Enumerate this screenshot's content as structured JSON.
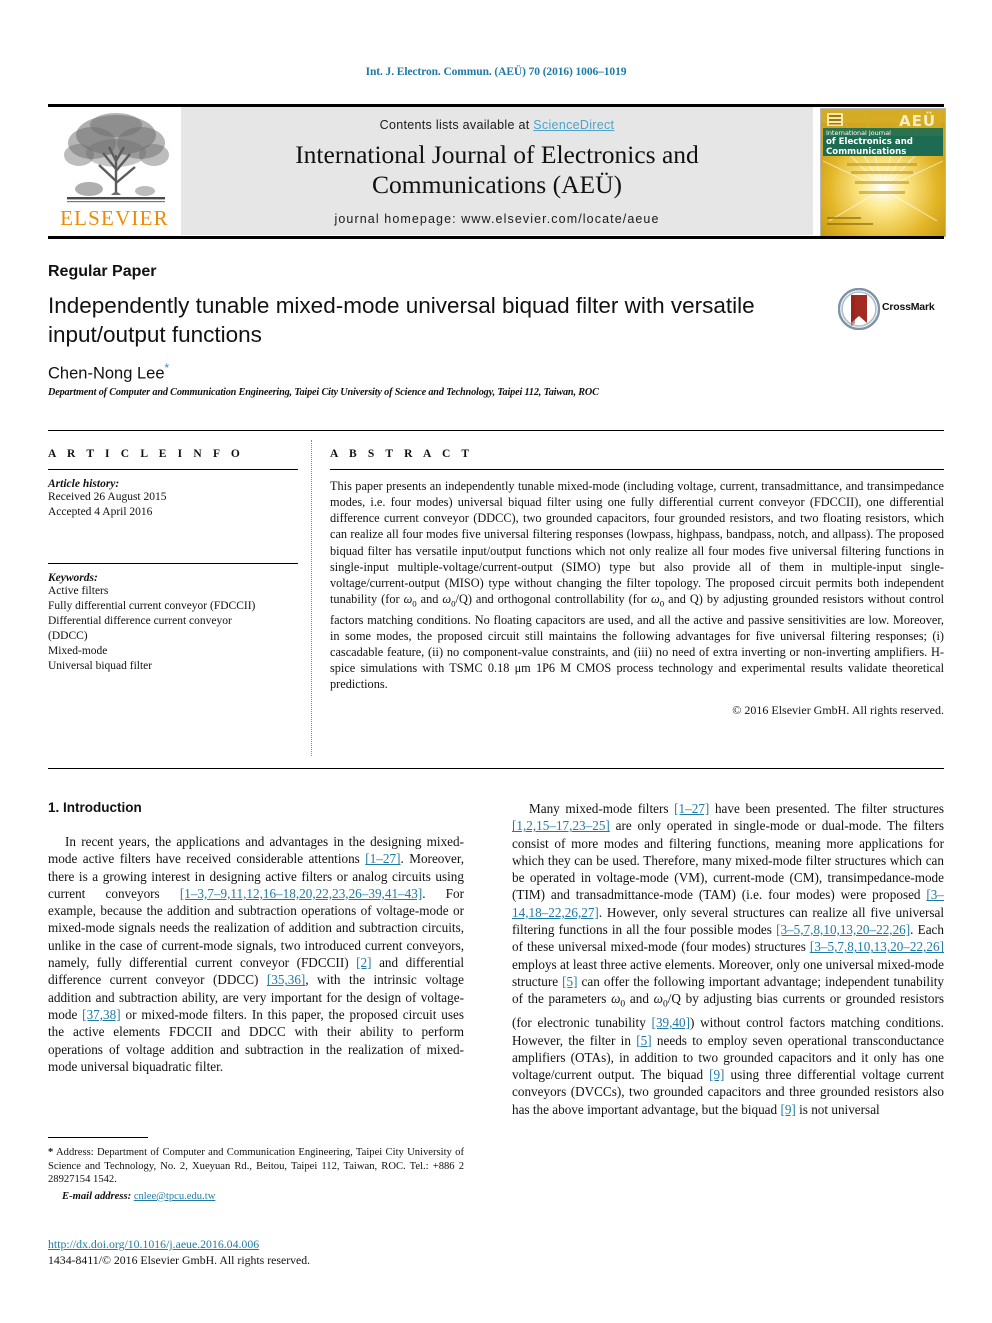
{
  "running_head": "Int. J. Electron. Commun. (AEÜ) 70 (2016) 1006–1019",
  "header": {
    "contents_prefix": "Contents lists available at ",
    "sciencedirect": "ScienceDirect",
    "journal_title_line1": "International Journal of Electronics and",
    "journal_title_line2": "Communications (AEÜ)",
    "homepage": "journal homepage: www.elsevier.com/locate/aeue",
    "publisher_wordmark": "ELSEVIER",
    "cover_line1": "International Journal",
    "cover_line2": "of Electronics and",
    "cover_line3": "Communications",
    "cover_badge": "AEÜ"
  },
  "article": {
    "type": "Regular Paper",
    "title": "Independently tunable mixed-mode universal biquad filter with versatile input/output functions",
    "author": "Chen-Nong Lee",
    "author_footnote_marker": "*",
    "affiliation": "Department of Computer and Communication Engineering, Taipei City University of Science and Technology, Taipei 112, Taiwan, ROC",
    "crossmark_label": "CrossMark"
  },
  "article_info": {
    "heading": "A R T I C L E   I N F O",
    "history_label": "Article history:",
    "history": [
      "Received 26 August 2015",
      "Accepted 4 April 2016"
    ],
    "keywords_label": "Keywords:",
    "keywords": [
      "Active filters",
      "Fully differential current conveyor (FDCCII)",
      "Differential difference current conveyor",
      "(DDCC)",
      "Mixed-mode",
      "Universal biquad filter"
    ]
  },
  "abstract": {
    "heading": "A B S T R A C T",
    "text_part1": "This paper presents an independently tunable mixed-mode (including voltage, current, transadmittance, and transimpedance modes, i.e. four modes) universal biquad filter using one fully differential current conveyor (FDCCII), one differential difference current conveyor (DDCC), two grounded capacitors, four grounded resistors, and two floating resistors, which can realize all four modes five universal filtering responses (lowpass, highpass, bandpass, notch, and allpass). The proposed biquad filter has versatile input/output functions which not only realize all four modes five universal filtering functions in single-input multiple-voltage/current-output (SIMO) type but also provide all of them in multiple-input single-voltage/current-output (MISO) type without changing the filter topology. The proposed circuit permits both independent tunability (for ",
    "omega_0_a": "ω",
    "sub0": "0",
    "text_part2": " and ",
    "text_part3": "/Q) and orthogonal controllability (for ",
    "text_part4": " and Q) by adjusting grounded resistors without control factors matching conditions. No floating capacitors are used, and all the active and passive sensitivities are low. Moreover, in some modes, the proposed circuit still maintains the following advantages for five universal filtering responses; (i) cascadable feature, (ii) no component-value constraints, and (iii) no need of extra inverting or non-inverting amplifiers. H-spice simulations with TSMC 0.18 μm 1P6 M CMOS process technology and experimental results validate theoretical predictions.",
    "copyright": "© 2016 Elsevier GmbH. All rights reserved."
  },
  "introduction": {
    "heading": "1. Introduction",
    "left_para1_a": "In recent years, the applications and advantages in the designing mixed-mode active filters have received considerable attentions ",
    "left_ref1": "[1–27]",
    "left_para1_b": ". Moreover, there is a growing interest in designing active filters or analog circuits using current conveyors ",
    "left_ref2": "[1–3,7–9,11,12,16–18,20,22,23,26–39,41–43]",
    "left_para1_c": ". For example, because the addition and subtraction operations of voltage-mode or mixed-mode signals needs the realization of addition and subtraction circuits, unlike in the case of current-mode signals, two introduced current conveyors, namely, fully differential current conveyor (FDCCII) ",
    "left_ref3": "[2]",
    "left_para1_d": " and differential difference current conveyor (DDCC) ",
    "left_ref4": "[35,36]",
    "left_para1_e": ", with the intrinsic voltage addition and subtraction ability, are very important for the design of voltage-mode ",
    "left_ref5": "[37,38]",
    "left_para1_f": " or mixed-mode filters. In this paper, the proposed circuit uses the active elements FDCCII and DDCC with their ability to perform operations of voltage addition and subtraction in the realization of mixed-mode universal biquadratic filter.",
    "right_para1_a": "Many mixed-mode filters ",
    "right_ref1": "[1–27]",
    "right_para1_b": " have been presented. The filter structures ",
    "right_ref2": "[1,2,15–17,23–25]",
    "right_para1_c": " are only operated in single-mode or dual-mode. The filters consist of more modes and filtering functions, meaning more applications for which they can be used. Therefore, many mixed-mode filter structures which can be operated in voltage-mode (VM), current-mode (CM), transimpedance-mode (TIM) and transadmittance-mode (TAM) (i.e. four modes) were proposed ",
    "right_ref3": "[3–14,18–22,26,27]",
    "right_para1_d": ". However, only several structures can realize all five universal filtering functions in all the four possible modes ",
    "right_ref4": "[3–5,7,8,10,13,20–22,26]",
    "right_para1_e": ". Each of these universal mixed-mode (four modes) structures ",
    "right_ref5": "[3–5,7,8,10,13,20–22,26]",
    "right_para1_f": " employs at least three active elements. Moreover, only one universal mixed-mode structure ",
    "right_ref6": "[5]",
    "right_para1_g": " can offer the following important advantage; independent tunability of the parameters ",
    "right_para1_h": " and ",
    "right_para1_i": "/Q by adjusting bias currents or grounded resistors (for electronic tunability ",
    "right_ref7": "[39,40]",
    "right_para1_j": ") without control factors matching conditions. However, the filter in ",
    "right_ref8": "[5]",
    "right_para1_k": " needs to employ seven operational transconductance amplifiers (OTAs), in addition to two grounded capacitors and it only has one voltage/current output. The biquad ",
    "right_ref9": "[9]",
    "right_para1_l": " using three differential voltage current conveyors (DVCCs), two grounded capacitors and three grounded resistors also has the above important advantage, but the biquad ",
    "right_ref10": "[9]",
    "right_para1_m": " is not universal"
  },
  "footnote": {
    "marker": "*",
    "address": " Address: Department of Computer and Communication Engineering, Taipei City University of Science and Technology, No. 2, Xueyuan Rd., Beitou, Taipei 112, Taiwan, ROC. Tel.: +886 2 28927154 1542.",
    "email_label": "E-mail address:",
    "email": "cnlee@tpcu.edu.tw"
  },
  "footer": {
    "doi": "http://dx.doi.org/10.1016/j.aeue.2016.04.006",
    "issn": "1434-8411/© 2016 Elsevier GmbH. All rights reserved."
  },
  "colors": {
    "link": "#1f7ba6",
    "sciencedirect": "#4ea3c9",
    "elsevier_orange": "#ED8B00",
    "band_gray": "#e6e6e6"
  }
}
